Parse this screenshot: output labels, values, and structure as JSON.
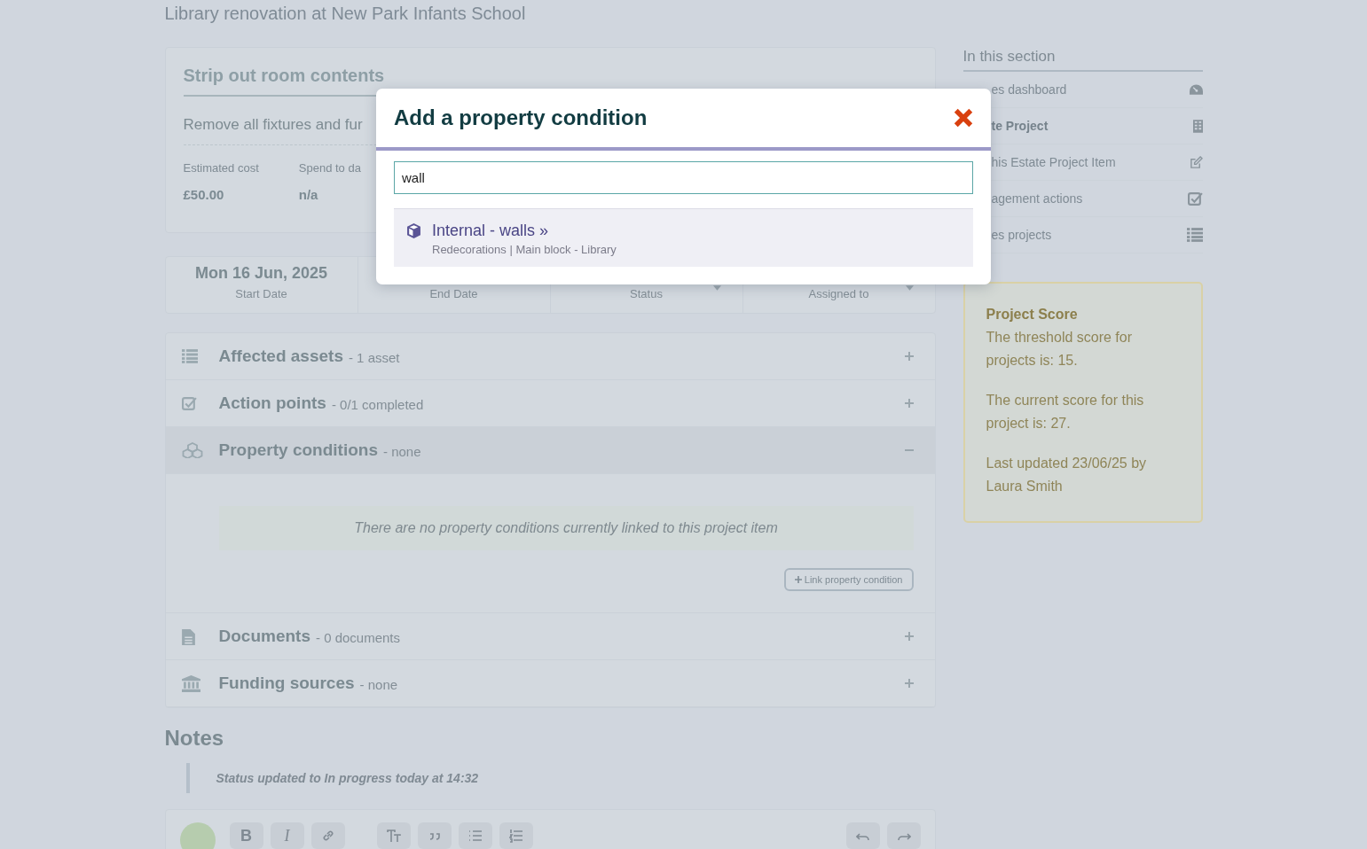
{
  "page": {
    "subtitle": "Library renovation at New Park Infants School"
  },
  "item": {
    "title": "Strip out room contents",
    "description": "Remove all fixtures and fur",
    "metrics": [
      {
        "label": "Estimated cost",
        "value": "£50.00"
      },
      {
        "label": "Spend to da",
        "value": "n/a"
      }
    ]
  },
  "fields": [
    {
      "kind": "date",
      "value": "Mon 16 Jun, 2025",
      "label": "Start Date"
    },
    {
      "kind": "date",
      "label": "End Date"
    },
    {
      "kind": "select",
      "label": "Status"
    },
    {
      "kind": "select",
      "label": "Assigned to"
    }
  ],
  "sections": [
    {
      "kind": "list",
      "title": "Affected assets",
      "summary": "- 1 asset",
      "expanded": false
    },
    {
      "kind": "check",
      "title": "Action points",
      "summary": "- 0/1 completed",
      "expanded": false
    },
    {
      "kind": "cubes",
      "title": "Property conditions",
      "summary": "- none",
      "expanded": true,
      "empty_message": "There are no property conditions currently linked to this project item",
      "action": "Link property condition"
    },
    {
      "kind": "document",
      "title": "Documents",
      "summary": "- 0 documents",
      "expanded": false
    },
    {
      "kind": "bank",
      "title": "Funding sources",
      "summary": "- none",
      "expanded": false
    }
  ],
  "notes": {
    "title": "Notes",
    "entries": [
      "Status updated to In progress today at 14:32"
    ]
  },
  "editor": {
    "tools": [
      {
        "kind": "bold",
        "label": "B"
      },
      {
        "kind": "italic",
        "label": "I"
      },
      {
        "kind": "link"
      },
      {
        "kind": "heading"
      },
      {
        "kind": "quote"
      },
      {
        "kind": "bullets"
      },
      {
        "kind": "numbers"
      },
      {
        "kind": "undo"
      },
      {
        "kind": "redo"
      }
    ]
  },
  "sidebar": {
    "title": "In this section",
    "items": [
      {
        "kind": "dashboard",
        "label": "es dashboard",
        "bold": false
      },
      {
        "kind": "building",
        "label": "te Project",
        "bold": true
      },
      {
        "kind": "edit",
        "label": "his Estate Project Item",
        "bold": false
      },
      {
        "kind": "check",
        "label": "agement actions",
        "bold": false
      },
      {
        "kind": "list",
        "label": "es projects",
        "bold": false
      }
    ]
  },
  "score": {
    "title": "Project Score",
    "paragraphs": [
      "The threshold score for projects is: 15.",
      "The current score for this project is: 27.",
      "Last updated 23/06/25 by Laura Smith"
    ]
  },
  "modal": {
    "title": "Add a property condition",
    "search": {
      "value": "wall"
    },
    "results": [
      {
        "title": "Internal - walls »",
        "subtitle": "Redecorations | Main block - Library"
      }
    ]
  }
}
